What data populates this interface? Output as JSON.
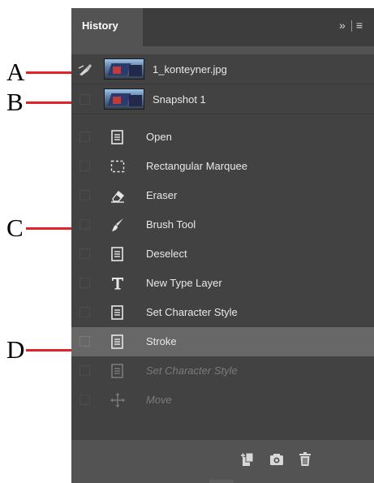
{
  "callouts": [
    "A",
    "B",
    "C",
    "D"
  ],
  "panel": {
    "tab_title": "History",
    "collapse_glyph": "»",
    "menu_glyph": "≡"
  },
  "snapshots": [
    {
      "label": "1_konteyner.jpg",
      "icon": "history-brush-source-icon"
    },
    {
      "label": "Snapshot 1",
      "icon": "none"
    }
  ],
  "steps": [
    {
      "label": "Open",
      "icon": "document-icon",
      "state": "normal"
    },
    {
      "label": "Rectangular Marquee",
      "icon": "marquee-icon",
      "state": "normal"
    },
    {
      "label": "Eraser",
      "icon": "eraser-icon",
      "state": "normal"
    },
    {
      "label": "Brush Tool",
      "icon": "brush-icon",
      "state": "normal"
    },
    {
      "label": "Deselect",
      "icon": "document-icon",
      "state": "normal"
    },
    {
      "label": "New Type Layer",
      "icon": "type-icon",
      "state": "normal"
    },
    {
      "label": "Set Character Style",
      "icon": "document-icon",
      "state": "normal"
    },
    {
      "label": "Stroke",
      "icon": "document-icon",
      "state": "active"
    },
    {
      "label": "Set Character Style",
      "icon": "document-icon",
      "state": "disabled"
    },
    {
      "label": "Move",
      "icon": "move-icon",
      "state": "disabled"
    }
  ],
  "footer_icons": [
    "new-document-from-state-icon",
    "camera-icon",
    "trash-icon"
  ],
  "colors": {
    "callout_line": "#e0232b",
    "panel_bg": "#535353",
    "list_bg": "#424242",
    "active_row": "#676767"
  }
}
